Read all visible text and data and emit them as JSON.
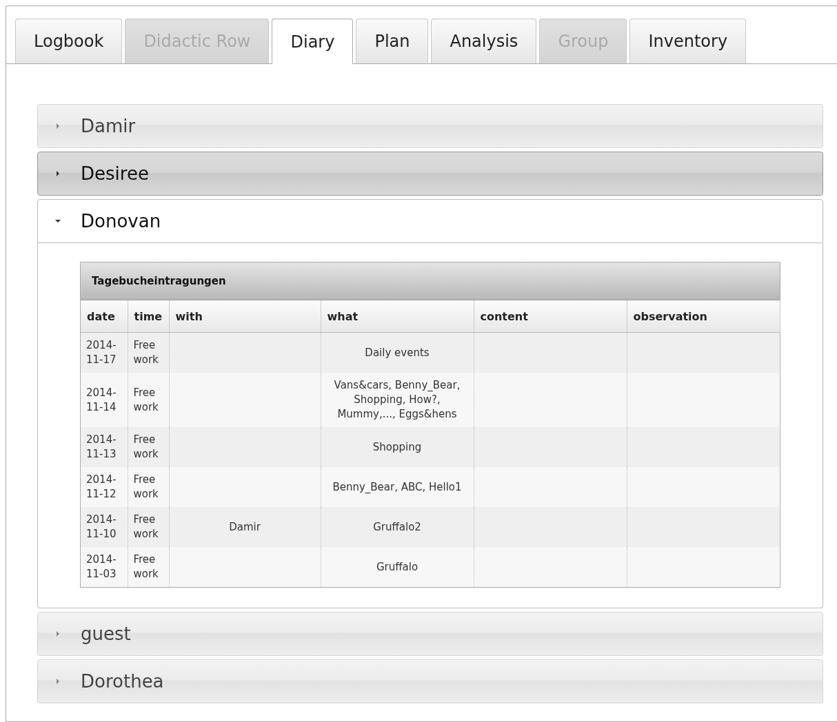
{
  "tabs": [
    {
      "label": "Logbook",
      "selected": false,
      "disabled": false
    },
    {
      "label": "Didactic Row",
      "selected": false,
      "disabled": true
    },
    {
      "label": "Diary",
      "selected": true,
      "disabled": false
    },
    {
      "label": "Plan",
      "selected": false,
      "disabled": false
    },
    {
      "label": "Analysis",
      "selected": false,
      "disabled": false
    },
    {
      "label": "Group",
      "selected": false,
      "disabled": true
    },
    {
      "label": "Inventory",
      "selected": false,
      "disabled": false
    }
  ],
  "accordion": [
    {
      "name": "Damir",
      "expanded": false,
      "hover": false
    },
    {
      "name": "Desiree",
      "expanded": false,
      "hover": true
    },
    {
      "name": "Donovan",
      "expanded": true,
      "hover": false,
      "table": {
        "caption": "Tagebucheintragungen",
        "columns": [
          "date",
          "time",
          "with",
          "what",
          "content",
          "observation"
        ],
        "rows": [
          [
            "2014-11-17",
            "Free work",
            "",
            "Daily events",
            "",
            ""
          ],
          [
            "2014-11-14",
            "Free work",
            "",
            "Vans&cars, Benny_Bear, Shopping, How?, Mummy,..., Eggs&hens",
            "",
            ""
          ],
          [
            "2014-11-13",
            "Free work",
            "",
            "Shopping",
            "",
            ""
          ],
          [
            "2014-11-12",
            "Free work",
            "",
            "Benny_Bear, ABC, Hello1",
            "",
            ""
          ],
          [
            "2014-11-10",
            "Free work",
            "Damir",
            "Gruffalo2",
            "",
            ""
          ],
          [
            "2014-11-03",
            "Free work",
            "",
            "Gruffalo",
            "",
            ""
          ]
        ]
      }
    },
    {
      "name": "guest",
      "expanded": false,
      "hover": false
    },
    {
      "name": "Dorothea",
      "expanded": false,
      "hover": false
    }
  ]
}
